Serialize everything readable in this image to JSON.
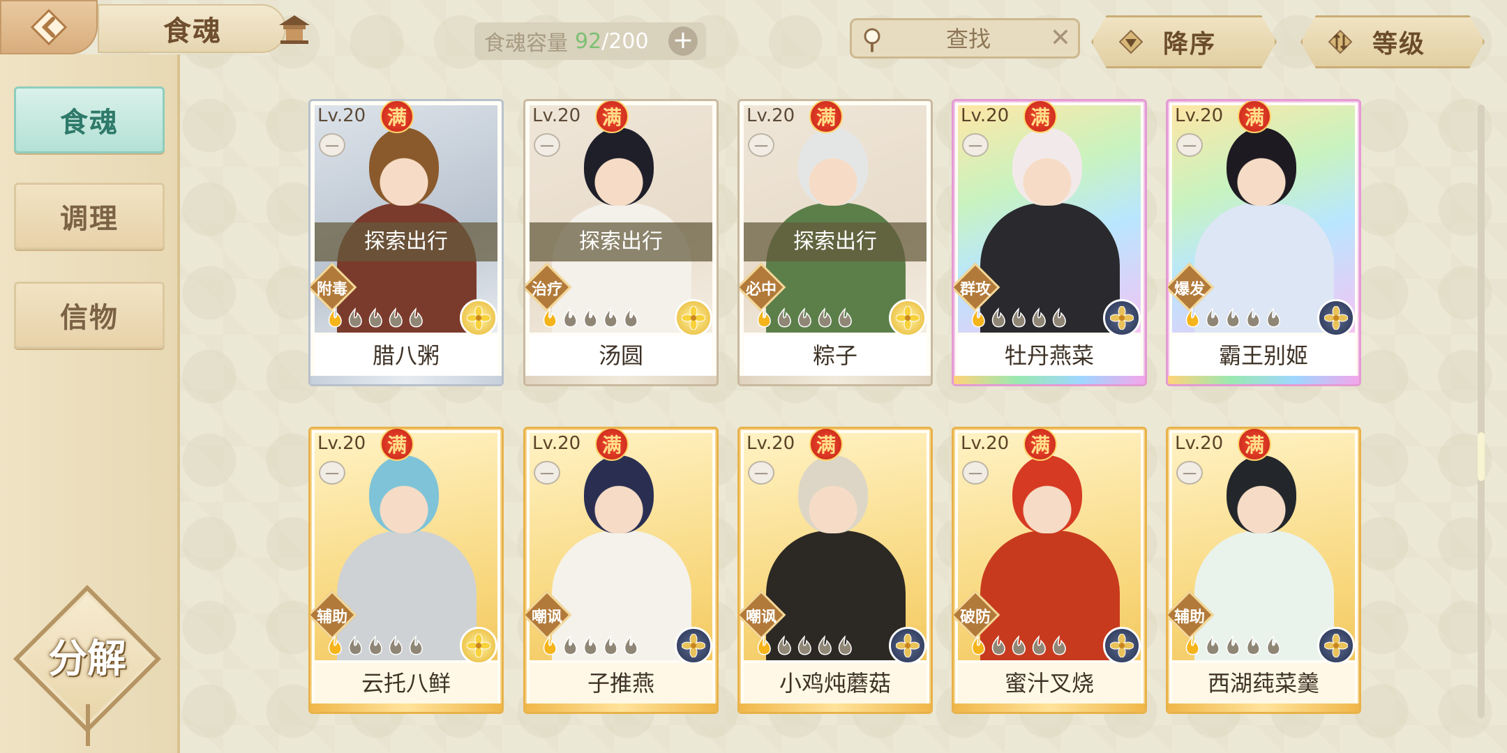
{
  "header": {
    "title": "食魂",
    "capacity_label": "食魂容量",
    "capacity_current": "92",
    "capacity_separator": "/",
    "capacity_max": "200",
    "search_placeholder": "查找",
    "sort_order_label": "降序",
    "sort_field_label": "等级"
  },
  "sidebar": {
    "items": [
      {
        "label": "食魂",
        "active": true
      },
      {
        "label": "调理",
        "active": false
      },
      {
        "label": "信物",
        "active": false
      }
    ],
    "decompose_label": "分解"
  },
  "cards": [
    {
      "level": "Lv.20",
      "max_badge": "满",
      "lock": "一",
      "status": "探索出行",
      "skill": "附毒",
      "flames_filled": 1,
      "flames_total": 5,
      "element": "gold",
      "name": "腊八粥",
      "rarity": "silver",
      "hair": "#8a5a2c",
      "outfit": "#7b3b2c"
    },
    {
      "level": "Lv.20",
      "max_badge": "满",
      "lock": "一",
      "status": "探索出行",
      "skill": "治疗",
      "flames_filled": 1,
      "flames_total": 5,
      "element": "gold",
      "name": "汤圆",
      "rarity": "silver2",
      "hair": "#1f1f2a",
      "outfit": "#f4f0ea"
    },
    {
      "level": "Lv.20",
      "max_badge": "满",
      "lock": "一",
      "status": "探索出行",
      "skill": "必中",
      "flames_filled": 1,
      "flames_total": 5,
      "element": "gold",
      "name": "粽子",
      "rarity": "silver2",
      "hair": "#e4e6e6",
      "outfit": "#5c7f4a"
    },
    {
      "level": "Lv.20",
      "max_badge": "满",
      "lock": "一",
      "status": "",
      "skill": "群攻",
      "flames_filled": 1,
      "flames_total": 5,
      "element": "blue",
      "name": "牡丹燕菜",
      "rarity": "rainbow",
      "hair": "#f2eaea",
      "outfit": "#2a2a2e"
    },
    {
      "level": "Lv.20",
      "max_badge": "满",
      "lock": "一",
      "status": "",
      "skill": "爆发",
      "flames_filled": 1,
      "flames_total": 5,
      "element": "blue",
      "name": "霸王别姬",
      "rarity": "rainbow",
      "hair": "#1e1a22",
      "outfit": "#dde6f4"
    },
    {
      "level": "Lv.20",
      "max_badge": "满",
      "lock": "一",
      "status": "",
      "skill": "辅助",
      "flames_filled": 1,
      "flames_total": 5,
      "element": "gold",
      "name": "云托八鲜",
      "rarity": "gold",
      "hair": "#7fc3d8",
      "outfit": "#cfd2d4"
    },
    {
      "level": "Lv.20",
      "max_badge": "满",
      "lock": "一",
      "status": "",
      "skill": "嘲讽",
      "flames_filled": 1,
      "flames_total": 5,
      "element": "blue",
      "name": "子推燕",
      "rarity": "gold",
      "hair": "#2a2f52",
      "outfit": "#f4f2ea"
    },
    {
      "level": "Lv.20",
      "max_badge": "满",
      "lock": "一",
      "status": "",
      "skill": "嘲讽",
      "flames_filled": 1,
      "flames_total": 5,
      "element": "blue",
      "name": "小鸡炖蘑菇",
      "rarity": "gold",
      "hair": "#ddd6c6",
      "outfit": "#2c2824"
    },
    {
      "level": "Lv.20",
      "max_badge": "满",
      "lock": "一",
      "status": "",
      "skill": "破防",
      "flames_filled": 1,
      "flames_total": 5,
      "element": "blue",
      "name": "蜜汁叉烧",
      "rarity": "gold",
      "hair": "#d63a22",
      "outfit": "#c83a1e"
    },
    {
      "level": "Lv.20",
      "max_badge": "满",
      "lock": "一",
      "status": "",
      "skill": "辅助",
      "flames_filled": 1,
      "flames_total": 5,
      "element": "blue",
      "name": "西湖莼菜羹",
      "rarity": "gold",
      "hair": "#23262a",
      "outfit": "#e9f3ec"
    }
  ],
  "colors": {
    "background": "#ece8d6",
    "accent_teal": "#8ecdbd",
    "capacity_green": "#7cc072",
    "max_badge_red": "#d8321f"
  }
}
